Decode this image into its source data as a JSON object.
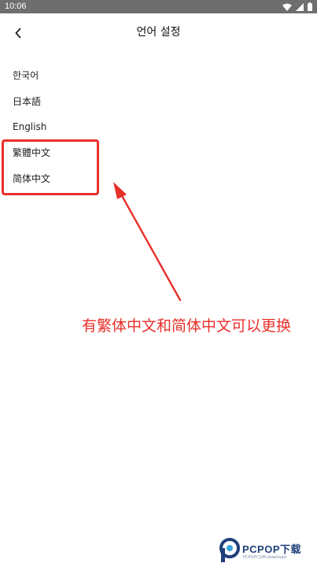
{
  "status_bar": {
    "time": "10:06",
    "icons": [
      "wifi-icon",
      "signal-icon",
      "battery-icon"
    ],
    "background": "#6e6e6e"
  },
  "header": {
    "back_icon": "chevron-left-icon",
    "title": "언어 설정"
  },
  "languages": [
    {
      "label": "한국어"
    },
    {
      "label": "日本語"
    },
    {
      "label": "English"
    },
    {
      "label": "繁體中文"
    },
    {
      "label": "简体中文"
    }
  ],
  "annotation": {
    "text": "有繁体中文和简体中文可以更换",
    "color": "#e8302b"
  },
  "watermark": {
    "brand": "PCPOP下载",
    "tagline": "PCPOP.COM download",
    "color": "#1f3f7a"
  }
}
